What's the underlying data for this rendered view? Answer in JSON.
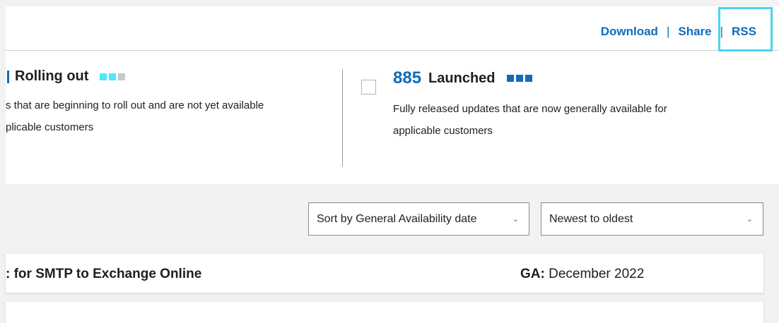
{
  "header": {
    "links": [
      {
        "label": "Download"
      },
      {
        "label": "Share"
      },
      {
        "label": "RSS"
      }
    ],
    "separator": "|"
  },
  "statuses": [
    {
      "title": "Rolling out",
      "count_fragment": "",
      "description_line1": "s that are beginning to roll out and are not yet available",
      "description_line2": "plicable customers",
      "squares": [
        "#50e6ff",
        "#50e6ff",
        "#c8c8c8"
      ]
    },
    {
      "title": "Launched",
      "count": "885",
      "description_line1": "Fully released updates that are now generally available for",
      "description_line2": "applicable customers",
      "squares": [
        "#0f6cbd",
        "#0f6cbd",
        "#0f6cbd"
      ]
    }
  ],
  "filters": {
    "sort_by": "Sort by General Availability date",
    "order": "Newest to oldest"
  },
  "results": [
    {
      "title": ": for SMTP to Exchange Online",
      "ga_label": "GA:",
      "ga_value": "December 2022"
    }
  ],
  "colors": {
    "accent": "#0f6cbd",
    "highlight": "#44d6f0"
  }
}
